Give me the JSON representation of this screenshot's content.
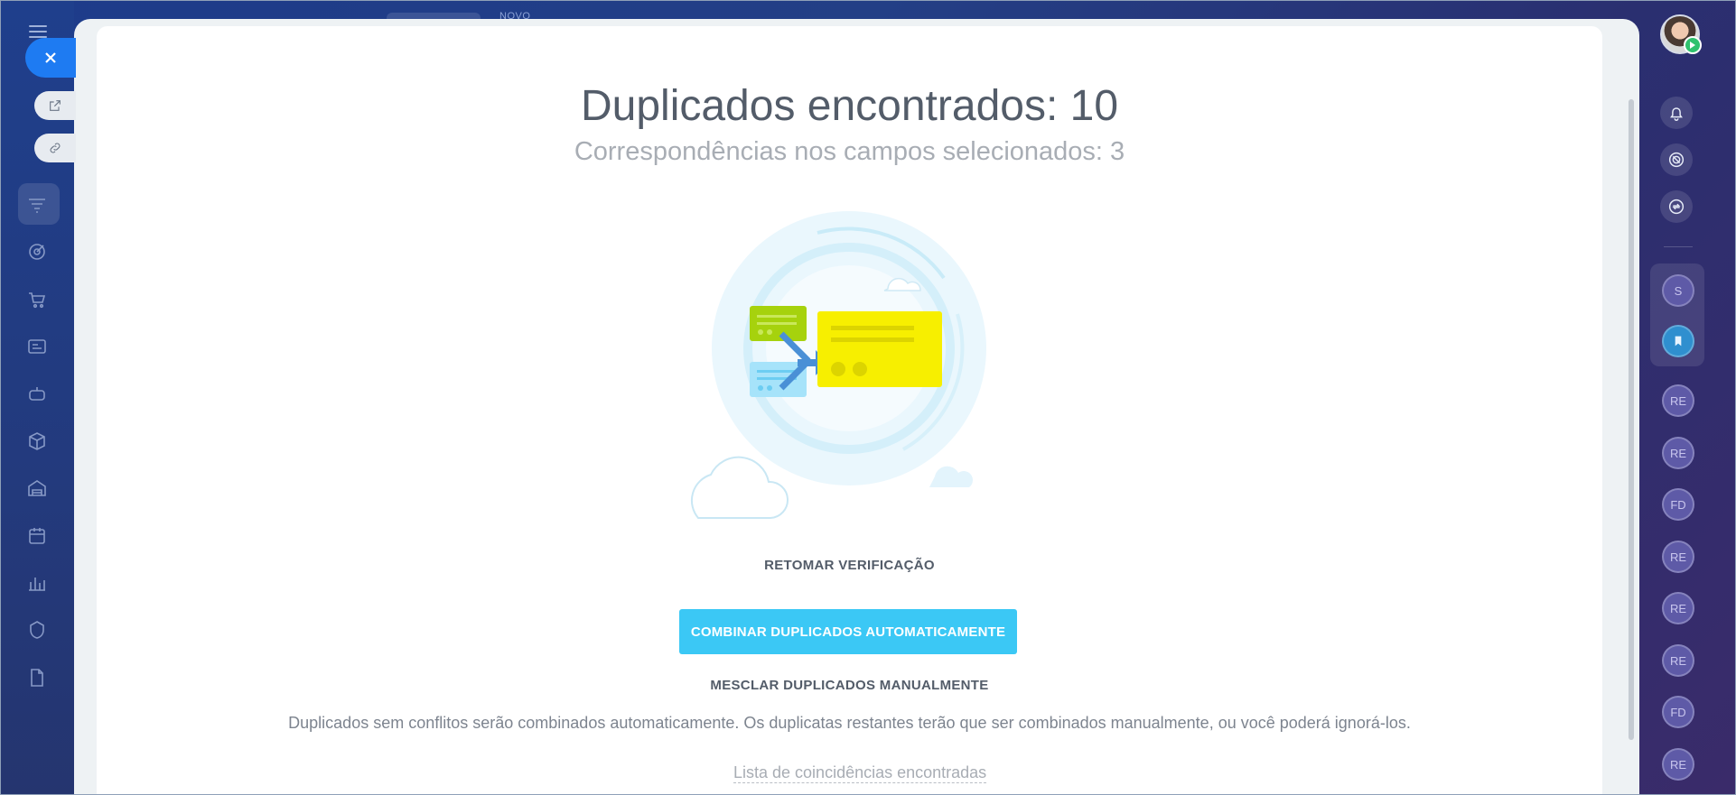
{
  "header": {
    "ghost_label": "NOVO"
  },
  "dialog": {
    "title": "Duplicados encontrados: 10",
    "subtitle": "Correspondências nos campos selecionados: 3",
    "resume_label": "RETOMAR VERIFICAÇÃO",
    "auto_merge_label": "COMBINAR DUPLICADOS AUTOMATICAMENTE",
    "manual_merge_label": "MESCLAR DUPLICADOS MANUALMENTE",
    "note": "Duplicados sem conflitos serão combinados automaticamente. Os duplicatas restantes terão que ser combinados manualmente, ou você poderá ignorá-los.",
    "matches_link": "Lista de coincidências encontradas"
  },
  "right_rail": {
    "chips": [
      "S",
      "RE",
      "RE",
      "FD",
      "RE",
      "RE",
      "RE",
      "FD",
      "RE"
    ]
  },
  "colors": {
    "accent": "#3bc8f5",
    "close_button": "#1e7bf2",
    "text": "#535c69"
  },
  "icons": {
    "left_rail": [
      "menu-icon",
      "filter-icon",
      "target-icon",
      "cart-icon",
      "card-icon",
      "robot-icon",
      "box-icon",
      "warehouse-icon",
      "calendar-icon",
      "chart-icon",
      "shield-icon",
      "document-icon"
    ],
    "right_rail": [
      "bell-icon",
      "target-icon",
      "chat-sync-icon",
      "bookmark-icon"
    ]
  }
}
